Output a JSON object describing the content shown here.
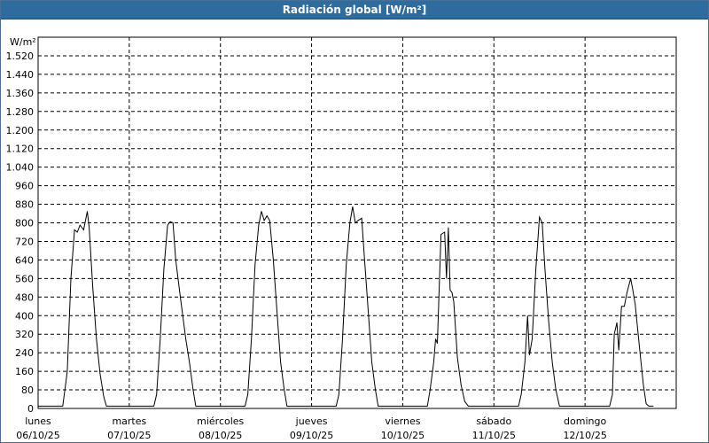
{
  "window": {
    "title": "Radiación global [W/m²]"
  },
  "chart_data": {
    "type": "line",
    "title": "Radiación global [W/m²]",
    "ylabel": "W/m²",
    "ylim": [
      0,
      1600
    ],
    "yticks": [
      0,
      80,
      160,
      240,
      320,
      400,
      480,
      560,
      640,
      720,
      800,
      880,
      960,
      1040,
      1120,
      1200,
      1280,
      1360,
      1440,
      1520
    ],
    "ytick_labels": [
      "0",
      "80",
      "160",
      "240",
      "320",
      "400",
      "480",
      "560",
      "640",
      "720",
      "800",
      "880",
      "960",
      "1.040",
      "1.120",
      "1.200",
      "1.280",
      "1.360",
      "1.440",
      "1.520"
    ],
    "xlim": [
      0,
      7
    ],
    "x_unit": "días desde lunes 06/10/25 00:00",
    "day_labels": [
      {
        "day": "lunes",
        "date": "06/10/25"
      },
      {
        "day": "martes",
        "date": "07/10/25"
      },
      {
        "day": "miércoles",
        "date": "08/10/25"
      },
      {
        "day": "jueves",
        "date": "09/10/25"
      },
      {
        "day": "viernes",
        "date": "10/10/25"
      },
      {
        "day": "sábado",
        "date": "11/10/25"
      },
      {
        "day": "domingo",
        "date": "12/10/25"
      }
    ],
    "grid": true,
    "series": [
      {
        "name": "Radiación global",
        "color": "#000000",
        "points": [
          [
            0.0,
            10
          ],
          [
            0.27,
            10
          ],
          [
            0.3,
            100
          ],
          [
            0.32,
            160
          ],
          [
            0.36,
            560
          ],
          [
            0.4,
            770
          ],
          [
            0.43,
            760
          ],
          [
            0.46,
            790
          ],
          [
            0.5,
            770
          ],
          [
            0.54,
            850
          ],
          [
            0.56,
            780
          ],
          [
            0.6,
            520
          ],
          [
            0.64,
            300
          ],
          [
            0.68,
            150
          ],
          [
            0.72,
            50
          ],
          [
            0.75,
            10
          ],
          [
            1.0,
            10
          ],
          [
            1.27,
            10
          ],
          [
            1.3,
            60
          ],
          [
            1.34,
            300
          ],
          [
            1.38,
            600
          ],
          [
            1.42,
            790
          ],
          [
            1.45,
            805
          ],
          [
            1.48,
            800
          ],
          [
            1.51,
            640
          ],
          [
            1.56,
            480
          ],
          [
            1.62,
            300
          ],
          [
            1.66,
            200
          ],
          [
            1.7,
            80
          ],
          [
            1.73,
            10
          ],
          [
            2.0,
            10
          ],
          [
            2.27,
            10
          ],
          [
            2.3,
            60
          ],
          [
            2.34,
            300
          ],
          [
            2.38,
            620
          ],
          [
            2.42,
            790
          ],
          [
            2.45,
            850
          ],
          [
            2.48,
            810
          ],
          [
            2.51,
            830
          ],
          [
            2.54,
            810
          ],
          [
            2.58,
            640
          ],
          [
            2.62,
            420
          ],
          [
            2.66,
            200
          ],
          [
            2.7,
            80
          ],
          [
            2.73,
            10
          ],
          [
            3.0,
            10
          ],
          [
            3.27,
            10
          ],
          [
            3.3,
            60
          ],
          [
            3.34,
            300
          ],
          [
            3.38,
            620
          ],
          [
            3.42,
            800
          ],
          [
            3.45,
            870
          ],
          [
            3.48,
            800
          ],
          [
            3.51,
            810
          ],
          [
            3.55,
            820
          ],
          [
            3.58,
            650
          ],
          [
            3.62,
            430
          ],
          [
            3.66,
            200
          ],
          [
            3.7,
            80
          ],
          [
            3.73,
            10
          ],
          [
            4.0,
            10
          ],
          [
            4.27,
            10
          ],
          [
            4.3,
            80
          ],
          [
            4.34,
            200
          ],
          [
            4.36,
            300
          ],
          [
            4.38,
            280
          ],
          [
            4.42,
            750
          ],
          [
            4.46,
            760
          ],
          [
            4.48,
            560
          ],
          [
            4.5,
            780
          ],
          [
            4.52,
            510
          ],
          [
            4.54,
            500
          ],
          [
            4.56,
            460
          ],
          [
            4.6,
            220
          ],
          [
            4.64,
            100
          ],
          [
            4.68,
            30
          ],
          [
            4.72,
            10
          ],
          [
            5.0,
            10
          ],
          [
            5.27,
            10
          ],
          [
            5.3,
            60
          ],
          [
            5.34,
            200
          ],
          [
            5.37,
            400
          ],
          [
            5.39,
            230
          ],
          [
            5.42,
            300
          ],
          [
            5.46,
            600
          ],
          [
            5.5,
            825
          ],
          [
            5.53,
            800
          ],
          [
            5.56,
            600
          ],
          [
            5.6,
            380
          ],
          [
            5.64,
            200
          ],
          [
            5.68,
            80
          ],
          [
            5.72,
            10
          ],
          [
            6.0,
            10
          ],
          [
            6.27,
            10
          ],
          [
            6.3,
            60
          ],
          [
            6.32,
            320
          ],
          [
            6.35,
            370
          ],
          [
            6.37,
            250
          ],
          [
            6.4,
            440
          ],
          [
            6.43,
            440
          ],
          [
            6.46,
            500
          ],
          [
            6.5,
            560
          ],
          [
            6.52,
            520
          ],
          [
            6.55,
            450
          ],
          [
            6.6,
            250
          ],
          [
            6.64,
            100
          ],
          [
            6.67,
            20
          ],
          [
            6.7,
            10
          ],
          [
            6.75,
            10
          ]
        ]
      }
    ]
  }
}
